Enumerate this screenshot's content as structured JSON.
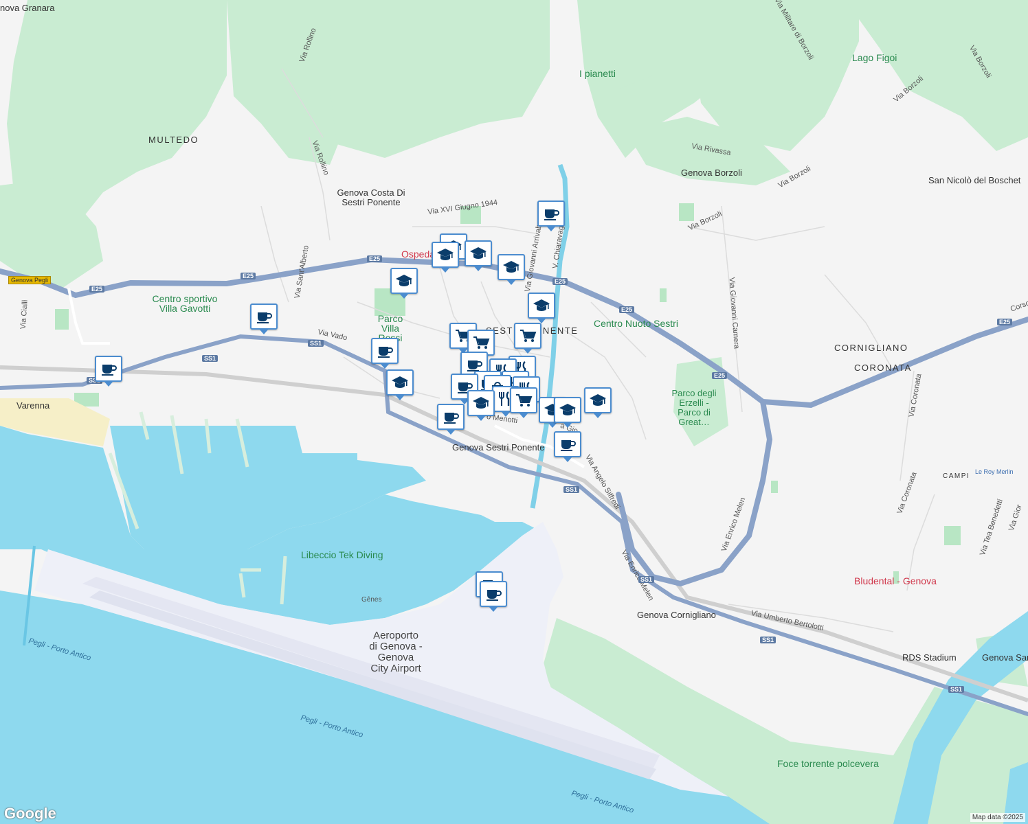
{
  "map": {
    "area_labels": [
      {
        "id": "multedo",
        "text": "MULTEDO"
      },
      {
        "id": "sestri",
        "text": "SESTRI PONENTE"
      },
      {
        "id": "cornigliano",
        "text": "CORNIGLIANO"
      },
      {
        "id": "coronata",
        "text": "CORONATA"
      },
      {
        "id": "campi",
        "text": "CAMPI"
      }
    ],
    "places": [
      {
        "id": "genova-granara",
        "text": "nova Granara"
      },
      {
        "id": "genova-pegli",
        "text": "Genova Pegli"
      },
      {
        "id": "villa-gavotti",
        "text": "Centro sportivo Villa Gavotti"
      },
      {
        "id": "varenna",
        "text": "Varenna"
      },
      {
        "id": "parco-villa-rossi",
        "text": "Parco Villa Rossi"
      },
      {
        "id": "costa-sestri",
        "text": "Genova Costa Di Sestri Ponente"
      },
      {
        "id": "ospedale",
        "text": "Ospeda"
      },
      {
        "id": "centro-nuoto",
        "text": "Centro Nuoto Sestri"
      },
      {
        "id": "genova-sestri-ponente",
        "text": "Genova Sestri Ponente"
      },
      {
        "id": "i-pianetti",
        "text": "I pianetti"
      },
      {
        "id": "lago-figoi",
        "text": "Lago Figoi"
      },
      {
        "id": "genova-borzoli",
        "text": "Genova Borzoli"
      },
      {
        "id": "san-nicolo",
        "text": "San Nicolò del Boschet"
      },
      {
        "id": "parco-erzelli",
        "text": "Parco degli Erzelli - Parco di Great…"
      },
      {
        "id": "libeccio",
        "text": "Libeccio Tek Diving"
      },
      {
        "id": "genes",
        "text": "Gênes"
      },
      {
        "id": "airport",
        "text": "Aeroporto di Genova - Genova City Airport"
      },
      {
        "id": "genova-cornigliano",
        "text": "Genova Cornigliano"
      },
      {
        "id": "bludental",
        "text": "Bludental - Genova"
      },
      {
        "id": "rds-stadium",
        "text": "RDS Stadium"
      },
      {
        "id": "genova-san",
        "text": "Genova San"
      },
      {
        "id": "foce",
        "text": "Foce torrente polcevera"
      },
      {
        "id": "le-roy",
        "text": "Le Roy Merlin"
      }
    ],
    "streets": [
      {
        "id": "via-rollino-1",
        "text": "Via Rollino"
      },
      {
        "id": "via-rollino-2",
        "text": "Via Rollino"
      },
      {
        "id": "via-sant-alberto",
        "text": "Via Sant'Alberto"
      },
      {
        "id": "via-vado",
        "text": "Via Vado"
      },
      {
        "id": "via-cialli",
        "text": "Via Cialli"
      },
      {
        "id": "via-xvi-giugno",
        "text": "Via XVI Giugno 1944"
      },
      {
        "id": "via-arrivabene",
        "text": "Via Giovanni Arrivabe"
      },
      {
        "id": "via-chiaravagna",
        "text": "V. Chiaravagna"
      },
      {
        "id": "via-menotti",
        "text": "o Menotti"
      },
      {
        "id": "via-siffredi",
        "text": "Via Angelo Siffredi"
      },
      {
        "id": "via-gio",
        "text": "a Gio"
      },
      {
        "id": "via-enrico-melen-1",
        "text": "Via Enrico Melen"
      },
      {
        "id": "via-enrico-melen-2",
        "text": "Via Enrico Melen"
      },
      {
        "id": "via-borzoli-1",
        "text": "Via Borzoli"
      },
      {
        "id": "via-borzoli-2",
        "text": "Via Borzoli"
      },
      {
        "id": "via-borzoli-3",
        "text": "Via Borzoli"
      },
      {
        "id": "via-borzoli-4",
        "text": "Via Borzoli"
      },
      {
        "id": "via-rivassa",
        "text": "Via Rivassa"
      },
      {
        "id": "via-militare",
        "text": "Via Militare di Borzoli"
      },
      {
        "id": "via-giovanni-camera",
        "text": "Via Giovanni Camera"
      },
      {
        "id": "via-coronata-1",
        "text": "Via Coronata"
      },
      {
        "id": "via-coronata-2",
        "text": "Via Coronata"
      },
      {
        "id": "via-umberto",
        "text": "Via Umberto Bertolotti"
      },
      {
        "id": "via-tea",
        "text": "Via Tea Benedetti"
      },
      {
        "id": "via-gior",
        "text": "Via Gior"
      },
      {
        "id": "corso",
        "text": "Corso"
      }
    ],
    "water_labels": [
      {
        "id": "pegli-1",
        "text": "Pegli - Porto Antico"
      },
      {
        "id": "pegli-2",
        "text": "Pegli - Porto Antico"
      },
      {
        "id": "pegli-3",
        "text": "Pegli - Porto Antico"
      }
    ],
    "road_shields": [
      "E25",
      "E25",
      "E25",
      "E25",
      "E25",
      "E25",
      "E25",
      "SS1",
      "SS1",
      "SS1",
      "SS1",
      "SS1",
      "SS1",
      "SS1"
    ],
    "attribution": "Map data ©2025",
    "google": "Google",
    "colors": {
      "sea": "#8ed9ee",
      "park": "#c6ebcf",
      "road": "#8aa2c8",
      "pin_border": "#4b8ccf",
      "pin_icon": "#0b3d6b"
    }
  }
}
